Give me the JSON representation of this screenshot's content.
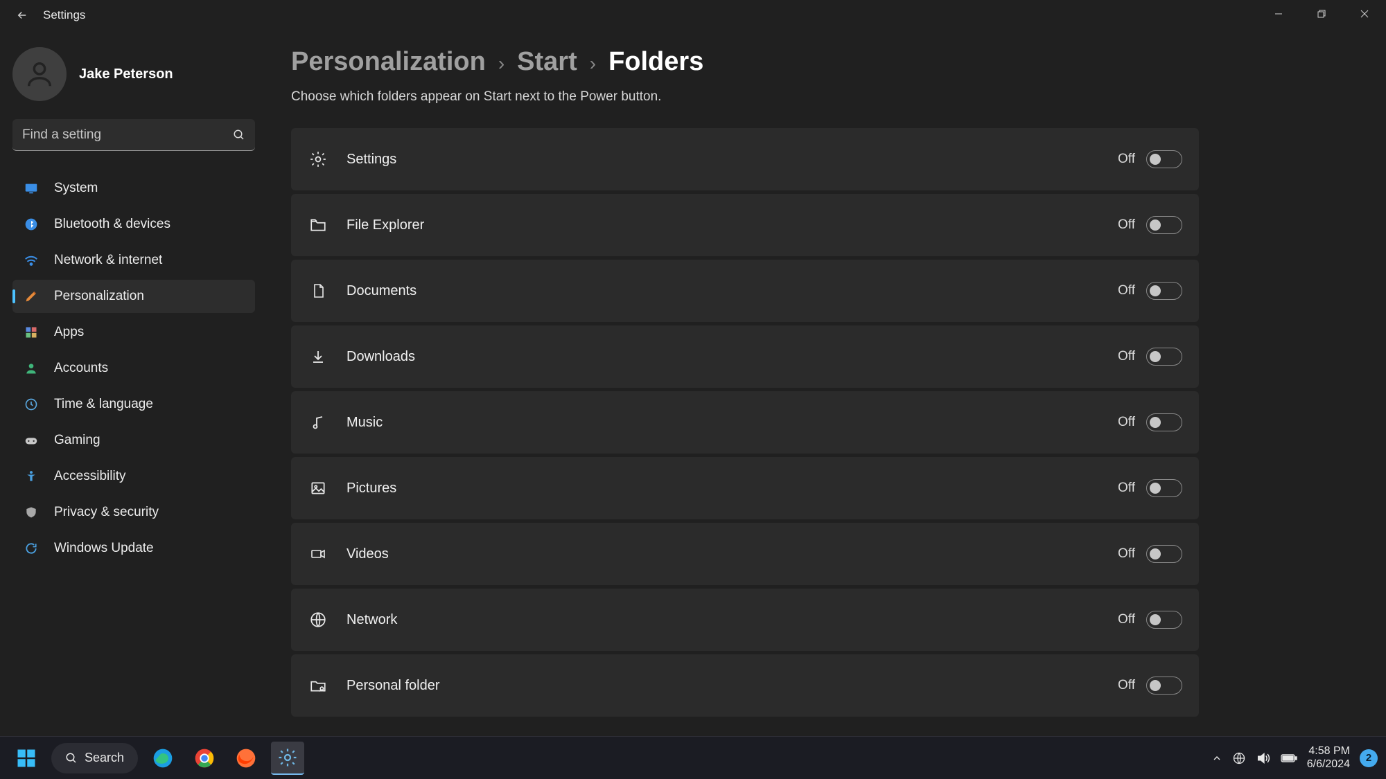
{
  "window": {
    "title": "Settings"
  },
  "user": {
    "name": "Jake Peterson"
  },
  "search": {
    "placeholder": "Find a setting"
  },
  "nav": {
    "items": [
      {
        "label": "System"
      },
      {
        "label": "Bluetooth & devices"
      },
      {
        "label": "Network & internet"
      },
      {
        "label": "Personalization"
      },
      {
        "label": "Apps"
      },
      {
        "label": "Accounts"
      },
      {
        "label": "Time & language"
      },
      {
        "label": "Gaming"
      },
      {
        "label": "Accessibility"
      },
      {
        "label": "Privacy & security"
      },
      {
        "label": "Windows Update"
      }
    ],
    "active_index": 3
  },
  "breadcrumb": {
    "root": "Personalization",
    "mid": "Start",
    "leaf": "Folders"
  },
  "subtitle": "Choose which folders appear on Start next to the Power button.",
  "toggle_state_label": "Off",
  "rows": [
    {
      "label": "Settings"
    },
    {
      "label": "File Explorer"
    },
    {
      "label": "Documents"
    },
    {
      "label": "Downloads"
    },
    {
      "label": "Music"
    },
    {
      "label": "Pictures"
    },
    {
      "label": "Videos"
    },
    {
      "label": "Network"
    },
    {
      "label": "Personal folder"
    }
  ],
  "taskbar": {
    "search_label": "Search",
    "time": "4:58 PM",
    "date": "6/6/2024",
    "notifications": "2"
  }
}
